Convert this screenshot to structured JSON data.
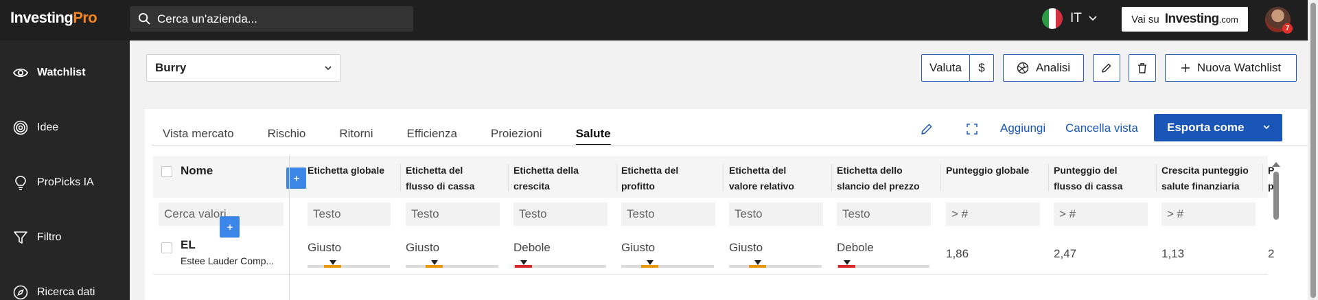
{
  "topbar": {
    "logo_main": "Investing",
    "logo_pro": "Pro",
    "search_placeholder": "Cerca un'azienda...",
    "lang_code": "IT",
    "vai_su": "Vai su",
    "vai_brand": "Investing",
    "vai_domain": ".com",
    "notif_count": "7"
  },
  "sidebar": {
    "items": [
      {
        "label": "Watchlist",
        "icon": "eye-icon"
      },
      {
        "label": "Idee",
        "icon": "target-icon"
      },
      {
        "label": "ProPicks IA",
        "icon": "lightbulb-icon"
      },
      {
        "label": "Filtro",
        "icon": "filter-icon"
      },
      {
        "label": "Ricerca dati",
        "icon": "compass-icon"
      }
    ]
  },
  "header": {
    "watchlist_name": "Burry",
    "valuta_label": "Valuta",
    "currency": "$",
    "analisi_label": "Analisi",
    "new_watchlist_label": "Nuova Watchlist"
  },
  "tabs": [
    {
      "label": "Vista mercato",
      "active": false
    },
    {
      "label": "Rischio",
      "active": false
    },
    {
      "label": "Ritorni",
      "active": false
    },
    {
      "label": "Efficienza",
      "active": false
    },
    {
      "label": "Proiezioni",
      "active": false
    },
    {
      "label": "Salute",
      "active": true
    }
  ],
  "toolbar": {
    "aggiungi": "Aggiungi",
    "cancella": "Cancella vista",
    "esporta": "Esporta come"
  },
  "table": {
    "name_header": "Nome",
    "name_filter_placeholder": "Cerca valori",
    "columns": [
      {
        "l1": "Etichetta globale",
        "l2": "",
        "filter": "Testo"
      },
      {
        "l1": "Etichetta del",
        "l2": "flusso di cassa",
        "filter": "Testo"
      },
      {
        "l1": "Etichetta della",
        "l2": "crescita",
        "filter": "Testo"
      },
      {
        "l1": "Etichetta del",
        "l2": "profitto",
        "filter": "Testo"
      },
      {
        "l1": "Etichetta del",
        "l2": "valore relativo",
        "filter": "Testo"
      },
      {
        "l1": "Etichetta dello",
        "l2": "slancio del prezzo",
        "filter": "Testo"
      },
      {
        "l1": "Punteggio globale",
        "l2": "",
        "filter": "> #"
      },
      {
        "l1": "Punteggio del",
        "l2": "flusso di cassa",
        "filter": "> #"
      },
      {
        "l1": "Crescita punteggio",
        "l2": "salute finanziaria",
        "filter": "> #"
      },
      {
        "l1": "P",
        "l2": "p",
        "filter": ""
      }
    ],
    "rows": [
      {
        "ticker": "EL",
        "company": "Estee Lauder Comp...",
        "labels": [
          {
            "text": "Giusto",
            "level": 0.3,
            "color": "#e8960c"
          },
          {
            "text": "Giusto",
            "level": 0.3,
            "color": "#e8960c"
          },
          {
            "text": "Debole",
            "level": 0.1,
            "color": "#d62a2a"
          },
          {
            "text": "Giusto",
            "level": 0.3,
            "color": "#e8960c"
          },
          {
            "text": "Giusto",
            "level": 0.3,
            "color": "#e8960c"
          },
          {
            "text": "Debole",
            "level": 0.1,
            "color": "#d62a2a"
          }
        ],
        "scores": [
          "1,86",
          "2,47",
          "1,13",
          "2"
        ]
      }
    ]
  },
  "colors": {
    "accent": "#1a56b8",
    "pro_orange": "#f58422",
    "fair": "#e8960c",
    "weak": "#d62a2a"
  }
}
